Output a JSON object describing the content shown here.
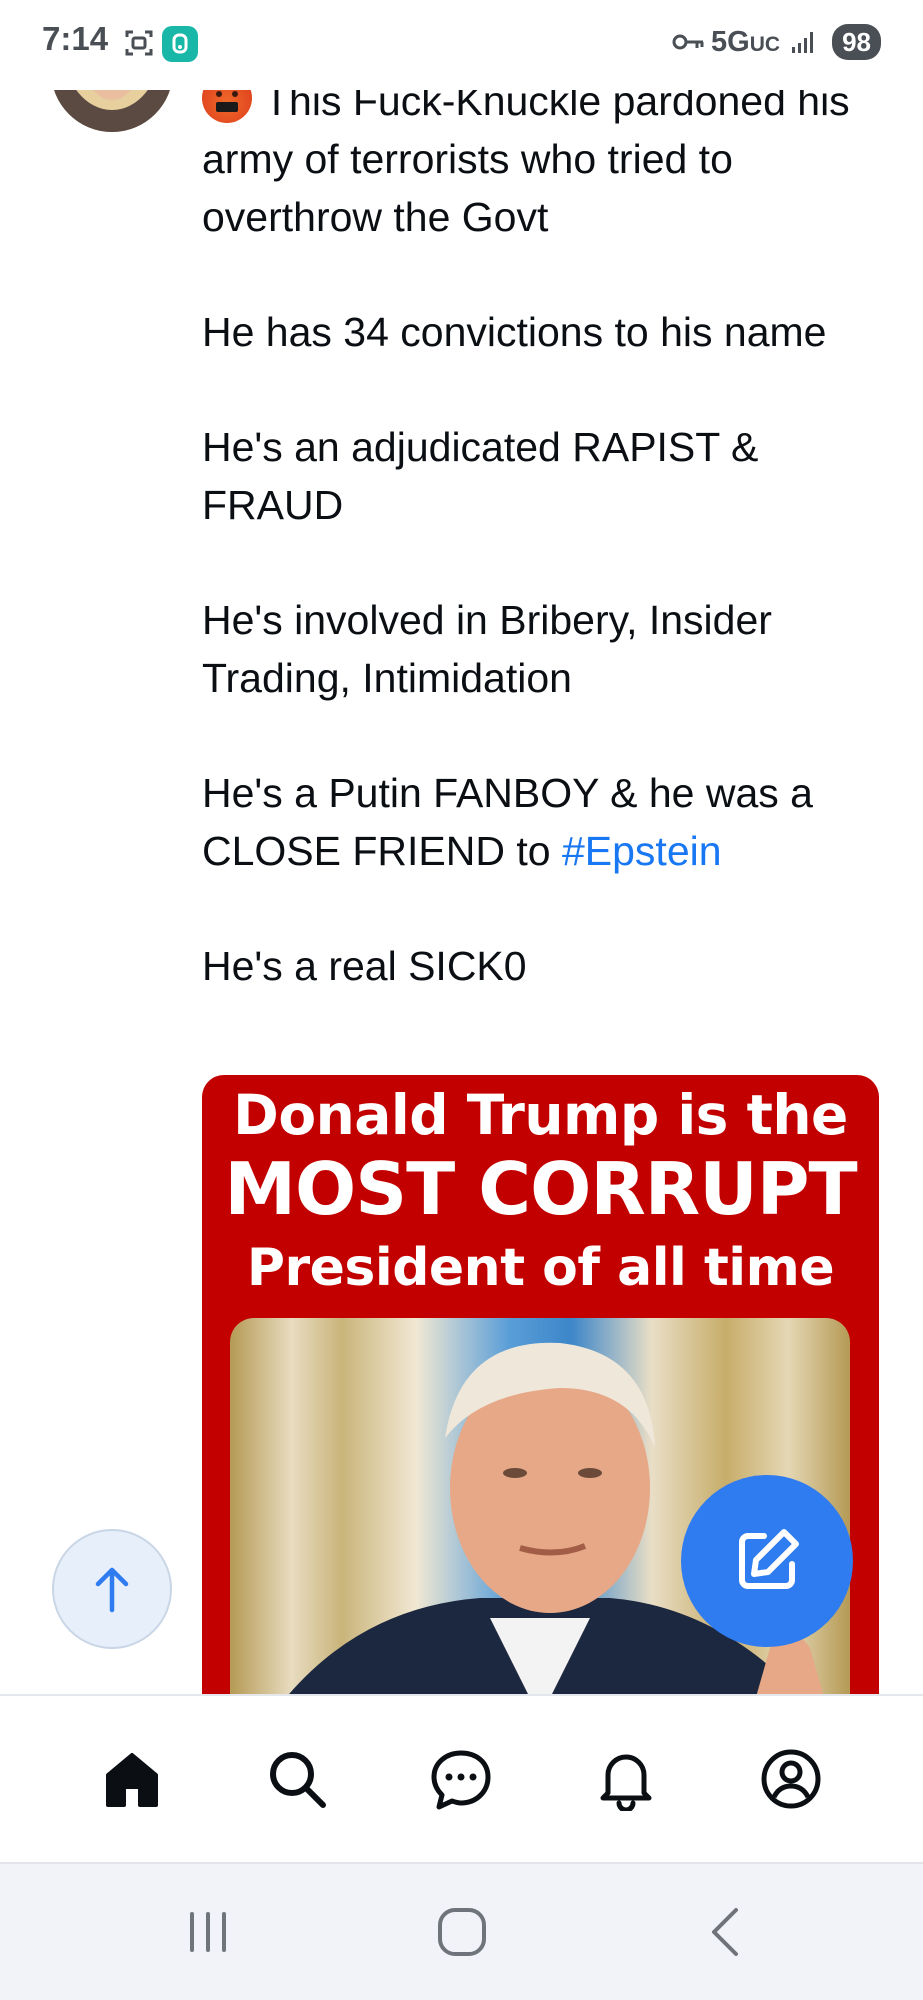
{
  "status_bar": {
    "time": "7:14",
    "network": "5G",
    "network_suffix": "UC",
    "battery": "98"
  },
  "post": {
    "paragraphs": [
      "This Fuck-Knuckle pardoned his army of terrorists who tried to overthrow the Govt",
      "He has 34 convictions to his name",
      "He's an adjudicated RAPIST & FRAUD",
      "He's involved in Bribery, Insider Trading, Intimidation",
      "He's a Putin FANBOY & he was a CLOSE FRIEND to ",
      "He's a real SICK0"
    ],
    "hashtag": "#Epstein",
    "hashtag_color": "#1877f2",
    "image": {
      "line1": "Donald Trump is the",
      "line2": "MOST CORRUPT",
      "line3": "President of all time",
      "background_color": "#c30000"
    }
  },
  "bottom_nav": {
    "items": [
      "home-icon",
      "search-icon",
      "chat-icon",
      "notifications-icon",
      "profile-icon"
    ],
    "active": "home-icon"
  },
  "accent_color": "#2f7bf0"
}
